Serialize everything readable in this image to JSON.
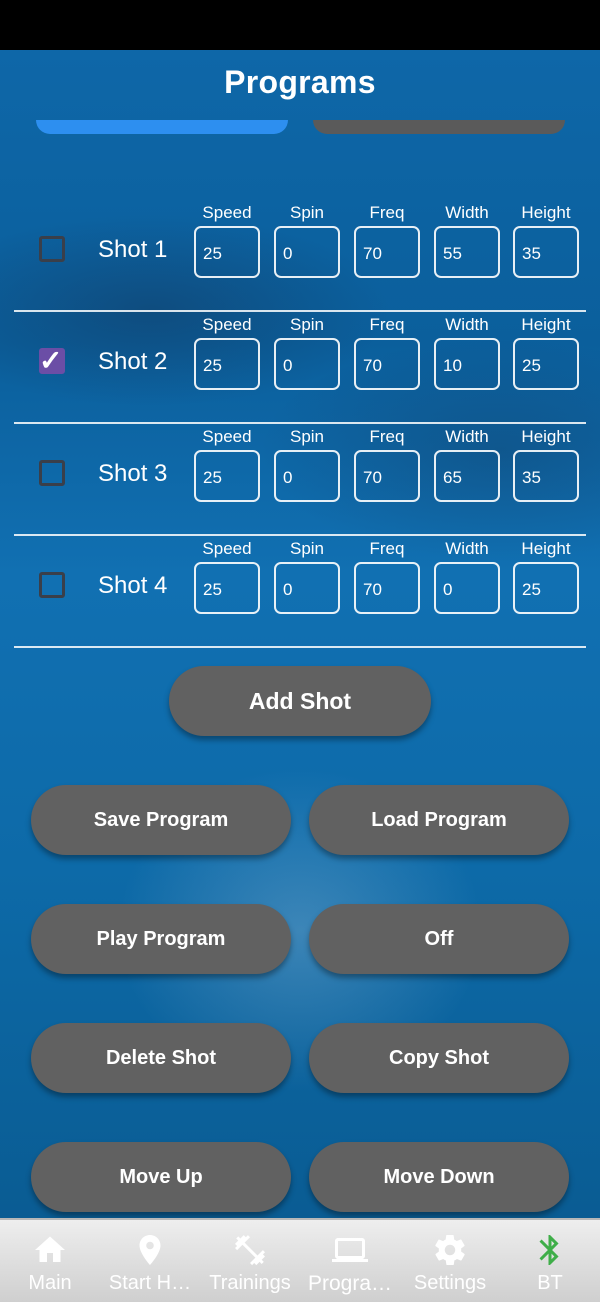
{
  "header": {
    "title": "Programs"
  },
  "shots": [
    {
      "label": "Shot 1",
      "checked": false,
      "params": [
        {
          "label": "Speed",
          "value": "25"
        },
        {
          "label": "Spin",
          "value": "0"
        },
        {
          "label": "Freq",
          "value": "70"
        },
        {
          "label": "Width",
          "value": "55"
        },
        {
          "label": "Height",
          "value": "35"
        }
      ]
    },
    {
      "label": "Shot 2",
      "checked": true,
      "params": [
        {
          "label": "Speed",
          "value": "25"
        },
        {
          "label": "Spin",
          "value": "0"
        },
        {
          "label": "Freq",
          "value": "70"
        },
        {
          "label": "Width",
          "value": "10"
        },
        {
          "label": "Height",
          "value": "25"
        }
      ]
    },
    {
      "label": "Shot 3",
      "checked": false,
      "params": [
        {
          "label": "Speed",
          "value": "25"
        },
        {
          "label": "Spin",
          "value": "0"
        },
        {
          "label": "Freq",
          "value": "70"
        },
        {
          "label": "Width",
          "value": "65"
        },
        {
          "label": "Height",
          "value": "35"
        }
      ]
    },
    {
      "label": "Shot 4",
      "checked": false,
      "params": [
        {
          "label": "Speed",
          "value": "25"
        },
        {
          "label": "Spin",
          "value": "0"
        },
        {
          "label": "Freq",
          "value": "70"
        },
        {
          "label": "Width",
          "value": "0"
        },
        {
          "label": "Height",
          "value": "25"
        }
      ]
    }
  ],
  "buttons": {
    "add_shot": "Add Shot",
    "save_program": "Save Program",
    "load_program": "Load Program",
    "play_program": "Play Program",
    "off": "Off",
    "delete_shot": "Delete Shot",
    "copy_shot": "Copy Shot",
    "move_up": "Move Up",
    "move_down": "Move Down"
  },
  "nav": {
    "items": [
      {
        "label": "Main",
        "icon": "home-icon"
      },
      {
        "label": "Start H…",
        "icon": "location-pin-icon"
      },
      {
        "label": "Trainings",
        "icon": "dumbbell-icon"
      },
      {
        "label": "Progra…",
        "icon": "laptop-icon",
        "active": true
      },
      {
        "label": "Settings",
        "icon": "gear-icon"
      },
      {
        "label": "BT",
        "icon": "bluetooth-icon"
      }
    ]
  },
  "colors": {
    "background": "#0d6aa8",
    "button": "#616161",
    "checkbox_checked": "#6b4ea6",
    "tab_active": "#2d8ff0",
    "bluetooth": "#3fae49"
  }
}
